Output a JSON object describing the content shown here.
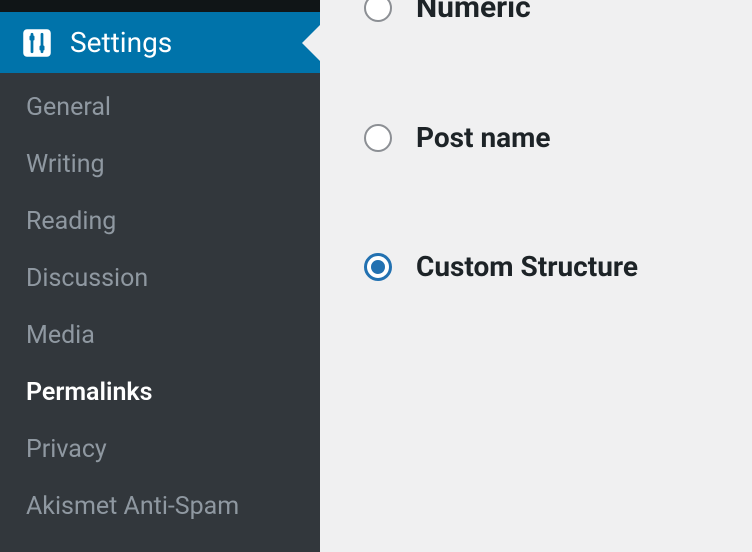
{
  "sidebar": {
    "header_label": "Settings",
    "items": [
      {
        "label": "General",
        "active": false
      },
      {
        "label": "Writing",
        "active": false
      },
      {
        "label": "Reading",
        "active": false
      },
      {
        "label": "Discussion",
        "active": false
      },
      {
        "label": "Media",
        "active": false
      },
      {
        "label": "Permalinks",
        "active": true
      },
      {
        "label": "Privacy",
        "active": false
      },
      {
        "label": "Akismet Anti-Spam",
        "active": false
      }
    ]
  },
  "permalink_options": [
    {
      "label": "Numeric",
      "selected": false
    },
    {
      "label": "Post name",
      "selected": false
    },
    {
      "label": "Custom Structure",
      "selected": true
    }
  ],
  "colors": {
    "accent": "#0073aa",
    "sidebar_bg": "#1d2327",
    "submenu_bg": "#32373c",
    "content_bg": "#f0f0f1",
    "radio_selected": "#2271b1"
  }
}
